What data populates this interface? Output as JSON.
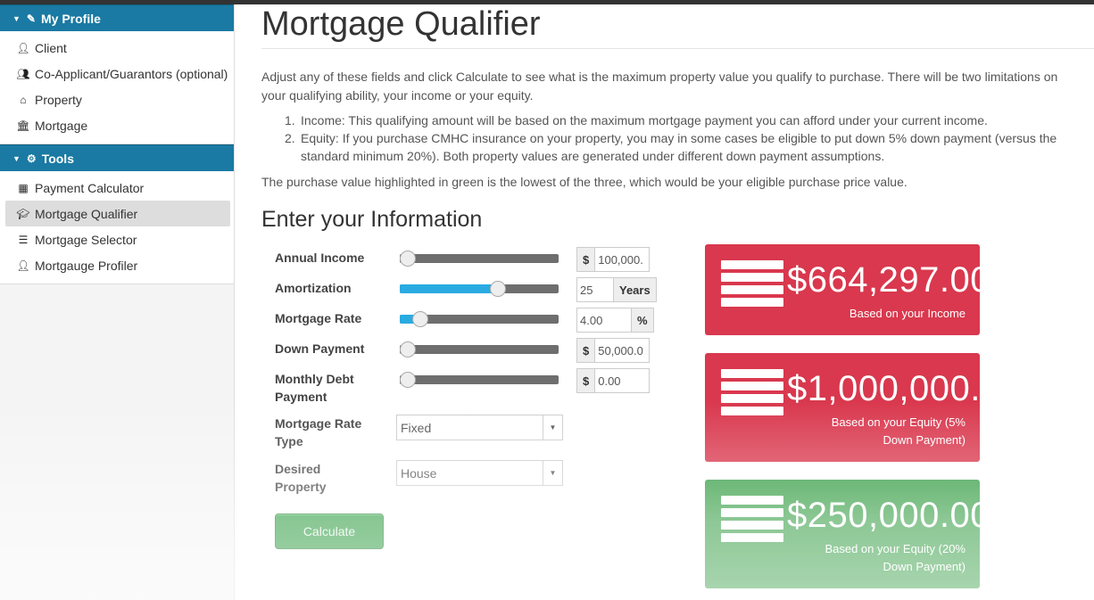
{
  "sidebar": {
    "profile_header": "My Profile",
    "profile_items": [
      {
        "label": "Client",
        "icon": "user-icon"
      },
      {
        "label": "Co-Applicant/Guarantors (optional)",
        "icon": "users-icon"
      },
      {
        "label": "Property",
        "icon": "home-icon"
      },
      {
        "label": "Mortgage",
        "icon": "bank-icon"
      }
    ],
    "tools_header": "Tools",
    "tools_items": [
      {
        "label": "Payment Calculator",
        "icon": "calculator-icon"
      },
      {
        "label": "Mortgage Qualifier",
        "icon": "graduation-cap-icon",
        "active": true
      },
      {
        "label": "Mortgage Selector",
        "icon": "list-icon"
      },
      {
        "label": "Mortgauge Profiler",
        "icon": "user-icon"
      }
    ]
  },
  "main": {
    "title": "Mortgage Qualifier",
    "intro": "Adjust any of these fields and click Calculate to see what is the maximum property value you qualify to purchase. There will be two limitations on your qualifying ability, your income or your equity.",
    "list": [
      {
        "num": "1.",
        "text": "Income: This qualifying amount will be based on the maximum mortgage payment you can afford under your current income."
      },
      {
        "num": "2.",
        "text": "Equity: If you purchase CMHC insurance on your property, you may in some cases be eligible to put down 5% down payment (versus the standard minimum 20%). Both property values are generated under different down payment assumptions."
      }
    ],
    "after": "The purchase value highlighted in green is the lowest of the three, which would be your eligible purchase price value.",
    "section_title": "Enter your Information"
  },
  "form": {
    "annual_income": {
      "label": "Annual Income",
      "prefix": "$",
      "value": "100,000.",
      "slider_fraction": 0.0
    },
    "amortization": {
      "label": "Amortization",
      "suffix": "Years",
      "value": "25",
      "slider_fraction": 0.62
    },
    "mortgage_rate": {
      "label": "Mortgage Rate",
      "suffix": "%",
      "value": "4.00",
      "slider_fraction": 0.13
    },
    "down_payment": {
      "label": "Down Payment",
      "prefix": "$",
      "value": "50,000.0",
      "slider_fraction": 0.0
    },
    "monthly_debt": {
      "label": "Monthly Debt Payment",
      "prefix": "$",
      "value": "0.00",
      "slider_fraction": 0.0
    },
    "rate_type": {
      "label": "Mortgage Rate Type",
      "value": "Fixed"
    },
    "desired_property": {
      "label": "Desired Property",
      "value": "House"
    },
    "calculate_label": "Calculate"
  },
  "results": [
    {
      "amount": "$664,297.00",
      "caption_1": "Based on your Income",
      "caption_2": "",
      "color": "#d9384e"
    },
    {
      "amount": "$1,000,000.",
      "caption_1": "Based on your Equity (5%",
      "caption_2": "Down Payment)",
      "color": "#d9384e"
    },
    {
      "amount": "$250,000.00",
      "caption_1": "Based on your Equity (20%",
      "caption_2": "Down Payment)",
      "color": "#2f9a3e"
    }
  ],
  "colors": {
    "sidebar_header": "#1a7aa3",
    "slider_fill": "#29abe2",
    "card_red": "#d9384e",
    "card_green": "#2f9a3e",
    "button_green": "#2a9a3d"
  }
}
